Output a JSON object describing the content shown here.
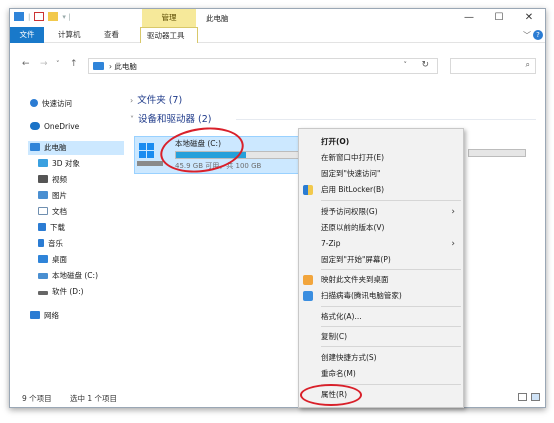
{
  "window": {
    "title": "此电脑",
    "manage_tab": "管理",
    "controls": {
      "minimize": "—",
      "maximize": "☐",
      "close": "✕"
    }
  },
  "ribbon": {
    "tabs": [
      "文件",
      "计算机",
      "查看",
      "驱动器工具"
    ],
    "expand": "﹀"
  },
  "nav": {
    "back": "←",
    "forward": "→",
    "recent": "˅",
    "up": "↑",
    "address_sep": "›",
    "address": "此电脑",
    "address_dropdown": "˅",
    "refresh": "↻",
    "search_icon": "⌕"
  },
  "sidebar": {
    "items": [
      {
        "label": "快速访问",
        "icon": "star-icon",
        "color": "#2b7cd3"
      },
      {
        "label": "OneDrive",
        "icon": "cloud-icon",
        "color": "#1a73c7"
      },
      {
        "label": "此电脑",
        "icon": "computer-icon",
        "color": "#2f84d9"
      },
      {
        "label": "3D 对象",
        "icon": "cube-icon",
        "color": "#3aa0e0"
      },
      {
        "label": "视频",
        "icon": "film-icon",
        "color": "#555555"
      },
      {
        "label": "图片",
        "icon": "picture-icon",
        "color": "#4a8fd1"
      },
      {
        "label": "文档",
        "icon": "document-icon",
        "color": "#6f8fb0"
      },
      {
        "label": "下载",
        "icon": "download-icon",
        "color": "#2b7cd3"
      },
      {
        "label": "音乐",
        "icon": "music-icon",
        "color": "#2b7cd3"
      },
      {
        "label": "桌面",
        "icon": "desktop-icon",
        "color": "#2f84d9"
      },
      {
        "label": "本地磁盘 (C:)",
        "icon": "drive-c-icon",
        "color": "#4a8fd1"
      },
      {
        "label": "软件 (D:)",
        "icon": "drive-icon",
        "color": "#666666"
      },
      {
        "label": "网络",
        "icon": "network-icon",
        "color": "#2b7cd3"
      }
    ]
  },
  "main": {
    "folders_header": "文件夹 (7)",
    "folders_chevron": "›",
    "drives_header": "设备和驱动器 (2)",
    "drives_chevron": "˅",
    "drive_c": {
      "name": "本地磁盘 (C:)",
      "meta": "45.9 GB 可用，共 100 GB",
      "used_fraction": 0.54
    }
  },
  "context_menu": {
    "items": [
      "打开(O)",
      "在新窗口中打开(E)",
      "固定到\"快速访问\"",
      "启用 BitLocker(B)",
      "授予访问权限(G)",
      "还原以前的版本(V)",
      "7-Zip",
      "固定到\"开始\"屏幕(P)",
      "映射此文件夹到桌面",
      "扫描病毒(腾讯电脑管家)",
      "格式化(A)...",
      "复制(C)",
      "创建快捷方式(S)",
      "重命名(M)",
      "属性(R)"
    ],
    "submenu_arrow": "›"
  },
  "status": {
    "items": "9 个项目",
    "selected": "选中 1 个项目"
  },
  "colors": {
    "accent": "#1979ca",
    "selection": "#cce8ff",
    "annotation": "#d9202a",
    "manage": "#f6e99a"
  }
}
